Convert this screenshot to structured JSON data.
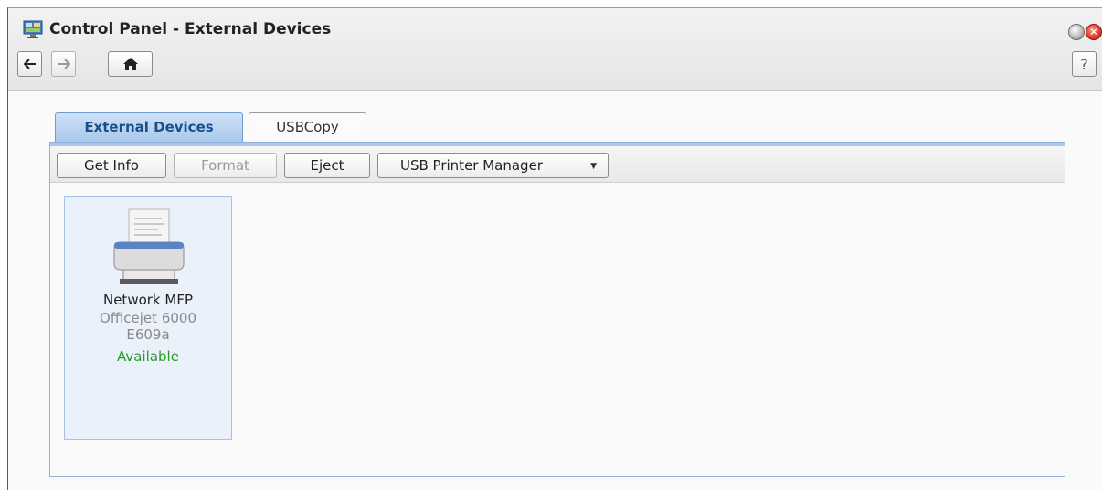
{
  "window": {
    "title": "Control Panel - External Devices",
    "help_label": "?"
  },
  "tabs": [
    {
      "label": "External Devices",
      "active": true
    },
    {
      "label": "USBCopy",
      "active": false
    }
  ],
  "toolbar": {
    "get_info_label": "Get Info",
    "format_label": "Format",
    "eject_label": "Eject",
    "usb_printer_manager_label": "USB Printer Manager"
  },
  "device": {
    "name": "Network MFP",
    "model_line1": "Officejet 6000",
    "model_line2": "E609a",
    "status": "Available",
    "status_color": "#2a9a2a",
    "icon": "printer-icon"
  },
  "colors": {
    "accent": "#1a4f8c",
    "tab_active_bg": "#a9c8ec",
    "close_red": "#e44b3a"
  }
}
